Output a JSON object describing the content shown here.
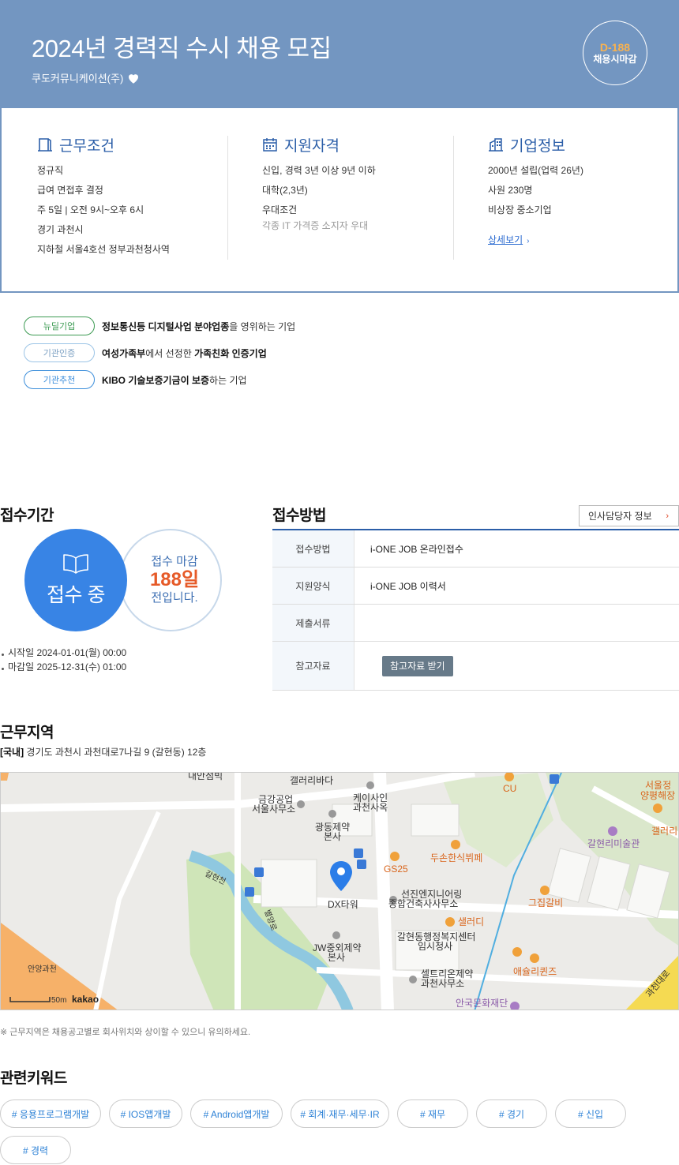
{
  "header": {
    "title": "2024년 경력직 수시 채용 모집",
    "company": "쿠도커뮤니케이션(주)",
    "dday": "D-188",
    "dday_sub": "채용시마감"
  },
  "conditions": {
    "title": "근무조건",
    "lines": [
      "정규직",
      "급여 면접후 결정",
      "주 5일 | 오전 9시~오후 6시",
      "경기 과천시",
      "지하철 서울4호선 정부과천청사역"
    ]
  },
  "qualifications": {
    "title": "지원자격",
    "lines": [
      "신입, 경력 3년 이상 9년 이하",
      "대학(2,3년)",
      "우대조건"
    ],
    "sub": "각종 IT 가격증 소지자 우대"
  },
  "company_info": {
    "title": "기업정보",
    "lines": [
      "2000년 설립(업력 26년)",
      "사원 230명",
      "비상장 중소기업"
    ],
    "link": "상세보기"
  },
  "badges": [
    {
      "label": "뉴딜기업",
      "strong": "정보통신등 디지털사업 분야업종",
      "rest": "을 영위하는 기업",
      "color": "#3d9b53"
    },
    {
      "label": "기관인증",
      "strong": "여성가족부",
      "mid": "에서 선정한 ",
      "strong2": "가족친화 인증기업",
      "color": "#7a9fc2"
    },
    {
      "label": "기관추천",
      "strong": "KIBO 기술보증기금이 보증",
      "rest": "하는 기업",
      "color": "#3c8edb"
    }
  ],
  "period": {
    "title": "접수기간",
    "status": "접수 중",
    "deadline_a": "접수 마감",
    "deadline_days": "188일",
    "deadline_c": "전입니다.",
    "start": "시작일 2024-01-01(월) 00:00",
    "end": "마감일 2025-12-31(수) 01:00"
  },
  "method": {
    "title": "접수방법",
    "hr_button": "인사담당자 정보",
    "rows": [
      {
        "key": "접수방법",
        "value": "i-ONE JOB 온라인접수"
      },
      {
        "key": "지원양식",
        "value": "i-ONE JOB 이력서"
      },
      {
        "key": "제출서류",
        "value": ""
      },
      {
        "key": "참고자료",
        "button": "참고자료 받기"
      }
    ]
  },
  "location": {
    "title": "근무지역",
    "tag": "[국내]",
    "address": "경기도 과천시 과천대로7나길 9 (갈현동) 12층",
    "note": "※ 근무지역은 채용공고별로 회사위치와 상이할 수 있으니 유의하세요.",
    "map_labels": [
      "갤러리바다",
      "내안점빅",
      "금강공업",
      "서울사무소",
      "케이사인",
      "과천사옥",
      "광동제약",
      "본사",
      "두손한식뷔페",
      "GS25",
      "CU",
      "DX타워",
      "선진엔지니어링",
      "종합건축사사무소",
      "샐러디",
      "갈현동행정복지센터",
      "임시청사",
      "JW중외제약",
      "본사",
      "셀트리온제약",
      "과천사무소",
      "애슐리퀸즈",
      "그집갈비",
      "갈현리미술관",
      "서울정",
      "양평해장",
      "갤러리",
      "안국문화재단",
      "안양과천",
      "갈현천",
      "별양로",
      "과천대로",
      "50m",
      "kakao"
    ]
  },
  "keywords": {
    "title": "관련키워드",
    "items": [
      "# 응용프로그램개발",
      "# IOS앱개발",
      "# Android앱개발",
      "# 회계·재무·세무·IR",
      "# 재무",
      "# 경기",
      "# 신입",
      "# 경력"
    ]
  }
}
